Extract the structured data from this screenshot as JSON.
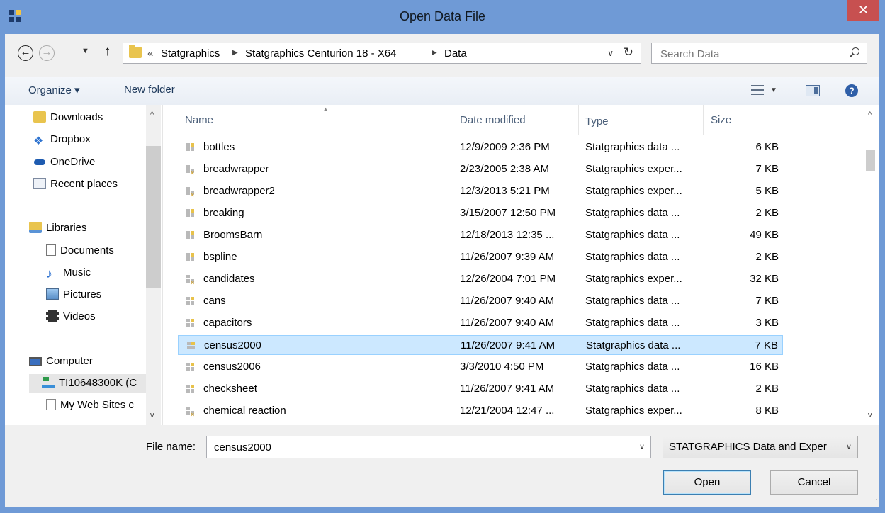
{
  "window": {
    "title": "Open Data File",
    "close_glyph": "✕"
  },
  "address": {
    "overflow": "«",
    "crumbs": [
      "Statgraphics",
      "Statgraphics Centurion 18 - X64",
      "Data"
    ],
    "separator": "▶",
    "dropdown_glyph": "∨",
    "refresh_glyph": "↻"
  },
  "nav_buttons": {
    "back": "←",
    "forward": "→",
    "recent": "▼",
    "up": "↑"
  },
  "search": {
    "placeholder": "Search Data"
  },
  "toolbar": {
    "organize": "Organize ▾",
    "new_folder": "New folder",
    "view_dropdown": "▼",
    "help": "?"
  },
  "nav_pane": {
    "items": [
      {
        "label": "Downloads",
        "icon": "downloads-folder-icon"
      },
      {
        "label": "Dropbox",
        "icon": "dropbox-icon"
      },
      {
        "label": "OneDrive",
        "icon": "onedrive-icon"
      },
      {
        "label": "Recent places",
        "icon": "recent-places-icon"
      },
      {
        "label": "Libraries",
        "icon": "libraries-icon"
      },
      {
        "label": "Documents",
        "icon": "documents-icon"
      },
      {
        "label": "Music",
        "icon": "music-icon"
      },
      {
        "label": "Pictures",
        "icon": "pictures-icon"
      },
      {
        "label": "Videos",
        "icon": "videos-icon"
      },
      {
        "label": "Computer",
        "icon": "computer-icon"
      },
      {
        "label": "TI10648300K (C",
        "icon": "drive-icon"
      },
      {
        "label": "My Web Sites c",
        "icon": "web-sites-icon"
      }
    ],
    "scroll_up": "^",
    "scroll_down": "v"
  },
  "columns": {
    "name": "Name",
    "date": "Date modified",
    "type": "Type",
    "size": "Size"
  },
  "files": [
    {
      "name": "bottles",
      "date": "12/9/2009 2:36 PM",
      "type": "Statgraphics data ...",
      "size": "6 KB",
      "kind": "data"
    },
    {
      "name": "breadwrapper",
      "date": "2/23/2005 2:38 AM",
      "type": "Statgraphics exper...",
      "size": "7 KB",
      "kind": "experiment"
    },
    {
      "name": "breadwrapper2",
      "date": "12/3/2013 5:21 PM",
      "type": "Statgraphics exper...",
      "size": "5 KB",
      "kind": "experiment"
    },
    {
      "name": "breaking",
      "date": "3/15/2007 12:50 PM",
      "type": "Statgraphics data ...",
      "size": "2 KB",
      "kind": "data"
    },
    {
      "name": "BroomsBarn",
      "date": "12/18/2013 12:35 ...",
      "type": "Statgraphics data ...",
      "size": "49 KB",
      "kind": "data"
    },
    {
      "name": "bspline",
      "date": "11/26/2007 9:39 AM",
      "type": "Statgraphics data ...",
      "size": "2 KB",
      "kind": "data"
    },
    {
      "name": "candidates",
      "date": "12/26/2004 7:01 PM",
      "type": "Statgraphics exper...",
      "size": "32 KB",
      "kind": "experiment"
    },
    {
      "name": "cans",
      "date": "11/26/2007 9:40 AM",
      "type": "Statgraphics data ...",
      "size": "7 KB",
      "kind": "data"
    },
    {
      "name": "capacitors",
      "date": "11/26/2007 9:40 AM",
      "type": "Statgraphics data ...",
      "size": "3 KB",
      "kind": "data"
    },
    {
      "name": "census2000",
      "date": "11/26/2007 9:41 AM",
      "type": "Statgraphics data ...",
      "size": "7 KB",
      "kind": "data",
      "selected": true
    },
    {
      "name": "census2006",
      "date": "3/3/2010 4:50 PM",
      "type": "Statgraphics data ...",
      "size": "16 KB",
      "kind": "data"
    },
    {
      "name": "checksheet",
      "date": "11/26/2007 9:41 AM",
      "type": "Statgraphics data ...",
      "size": "2 KB",
      "kind": "data"
    },
    {
      "name": "chemical reaction",
      "date": "12/21/2004 12:47 ...",
      "type": "Statgraphics exper...",
      "size": "8 KB",
      "kind": "experiment"
    }
  ],
  "file_name": {
    "label": "File name:",
    "value": "census2000",
    "dropdown_glyph": "∨"
  },
  "file_type": {
    "selected": "STATGRAPHICS Data and Exper",
    "dropdown_glyph": "∨"
  },
  "buttons": {
    "open": "Open",
    "cancel": "Cancel"
  },
  "colors": {
    "title_bar": "#6f9ad6",
    "close": "#c75050",
    "selection": "#cce8ff"
  }
}
